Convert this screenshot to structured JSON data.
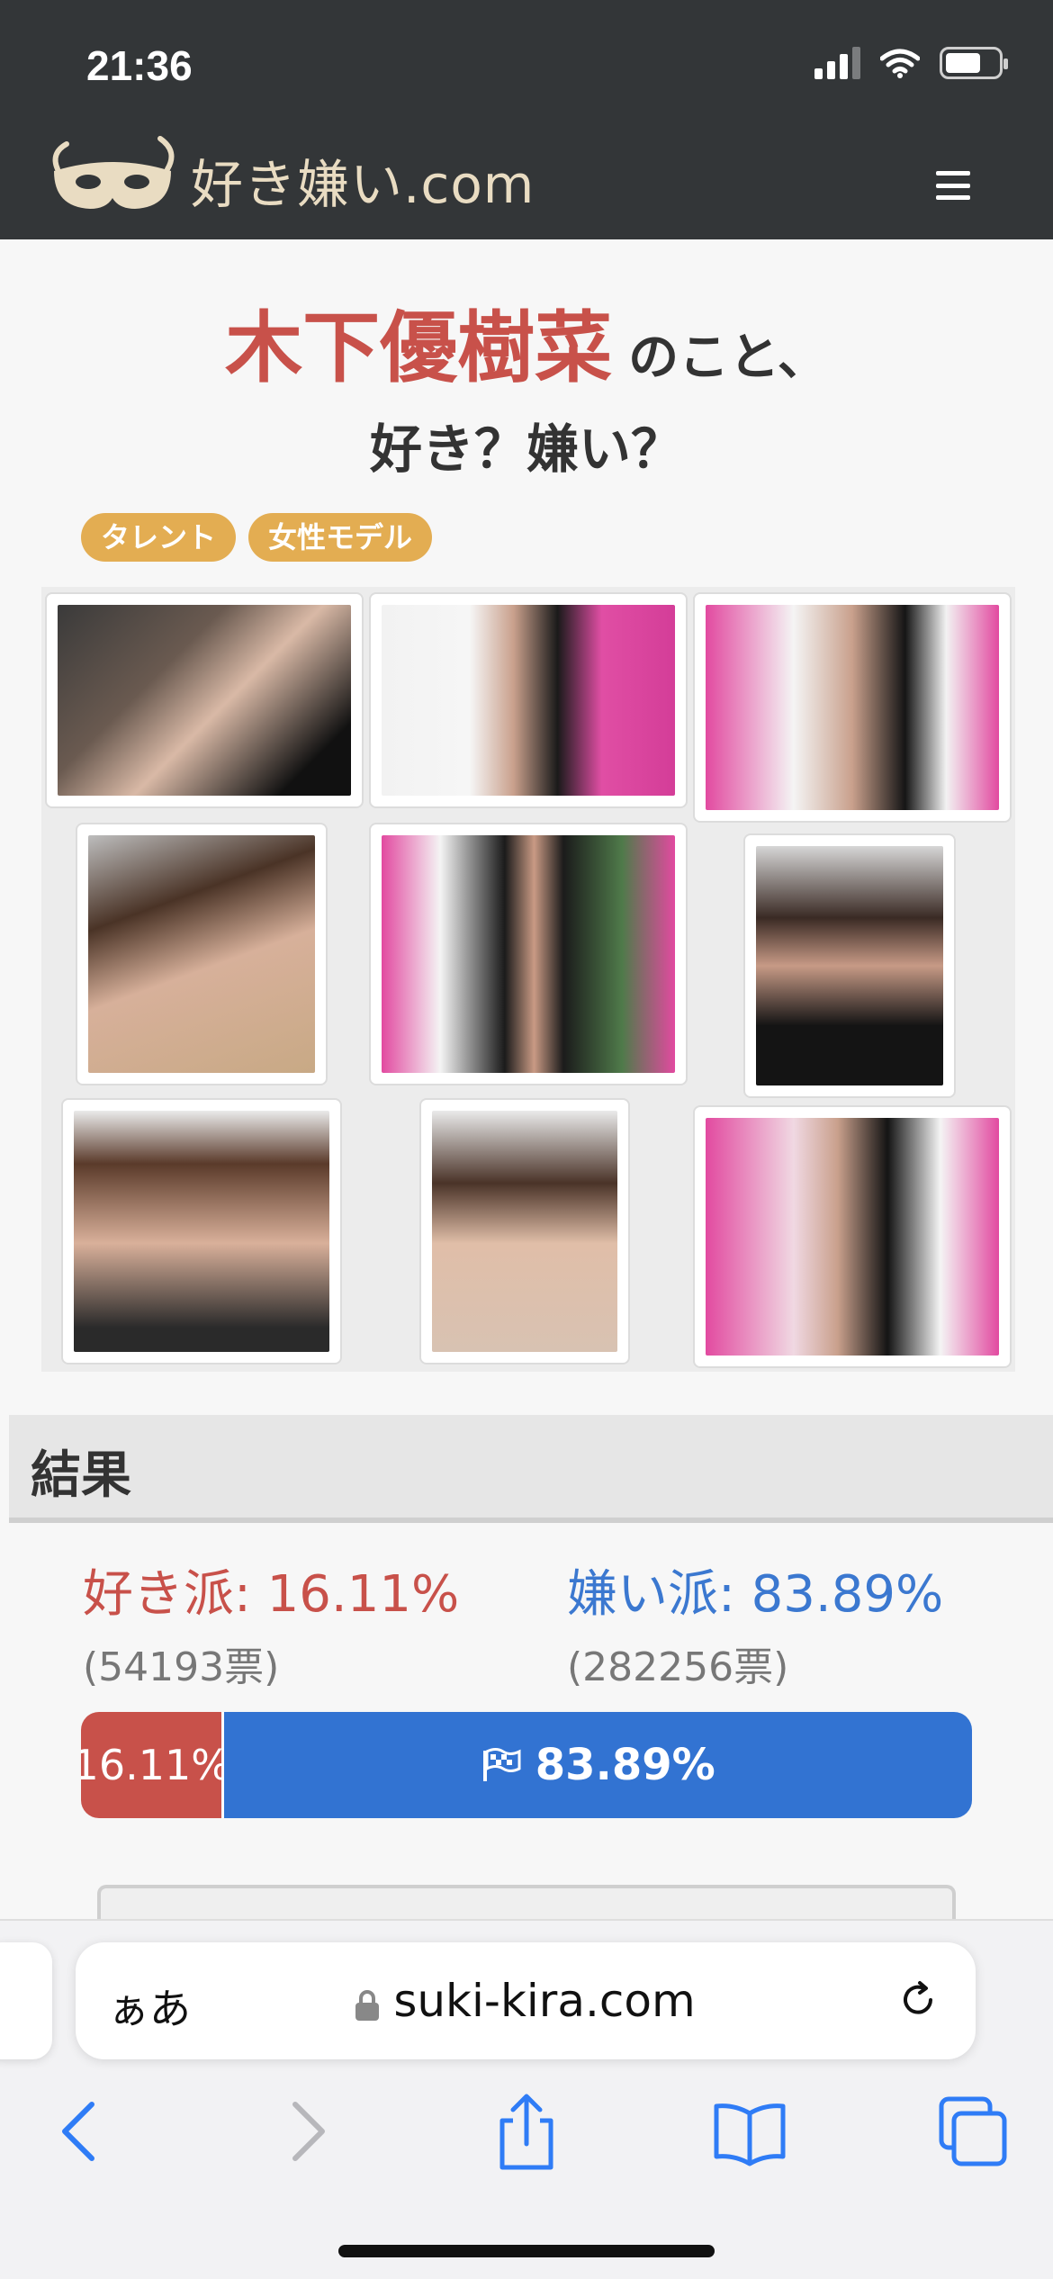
{
  "status_bar": {
    "time": "21:36"
  },
  "site": {
    "logo_text": "好き嫌い.com",
    "menu_icon": "hamburger-icon"
  },
  "page": {
    "name": "木下優樹菜",
    "suffix": "のこと、",
    "question": "好き？嫌い？",
    "tags": [
      "タレント",
      "女性モデル"
    ]
  },
  "gallery": {
    "photo_count": 9
  },
  "results": {
    "header": "結果",
    "like_label": "好き派: 16.11%",
    "like_votes": "(54193票)",
    "dislike_label": "嫌い派: 83.89%",
    "dislike_votes": "(282256票)",
    "like_percent": 16.11,
    "bar_like_text": "16.11%",
    "bar_dislike_text": "83.89%"
  },
  "browser": {
    "aa_label": "ぁあ",
    "domain": "suki-kira.com",
    "nav": [
      "back-icon",
      "forward-icon",
      "share-icon",
      "bookmarks-icon",
      "tabs-icon"
    ]
  },
  "colors": {
    "like": "#c8514a",
    "dislike": "#3273d2",
    "tag": "#e3ad52",
    "header_bg": "#333638"
  }
}
